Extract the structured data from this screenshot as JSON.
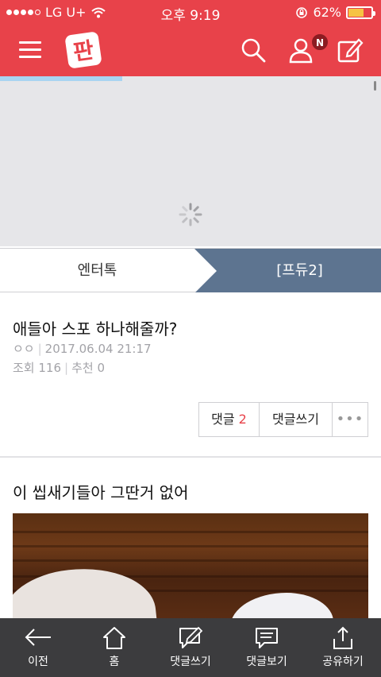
{
  "status_bar": {
    "carrier": "LG U+",
    "time": "오후 9:19",
    "battery": "62%",
    "battery_level": 0.62
  },
  "header": {
    "logo_text": "판",
    "notification_badge": "N",
    "brand_color": "#e8424a"
  },
  "loading": {
    "progress": 0.32
  },
  "tabs": {
    "left": "엔터톡",
    "right": "[프듀2]"
  },
  "posts": [
    {
      "title": "애들아 스포 하나해줄까?",
      "author": "ㅇㅇ",
      "date": "2017.06.04 21:17",
      "views_label": "조회",
      "views": "116",
      "likes_label": "추천",
      "likes": "0",
      "comments_label": "댓글",
      "comments_count": "2",
      "write_comment": "댓글쓰기",
      "more": "•••"
    },
    {
      "title": "이 씹새기들아 그딴거 없어"
    }
  ],
  "toolbar": {
    "items": [
      {
        "label": "이전",
        "icon": "arrow-left-icon"
      },
      {
        "label": "홈",
        "icon": "home-icon"
      },
      {
        "label": "댓글쓰기",
        "icon": "edit-comment-icon"
      },
      {
        "label": "댓글보기",
        "icon": "comment-icon"
      },
      {
        "label": "공유하기",
        "icon": "share-icon"
      }
    ]
  }
}
